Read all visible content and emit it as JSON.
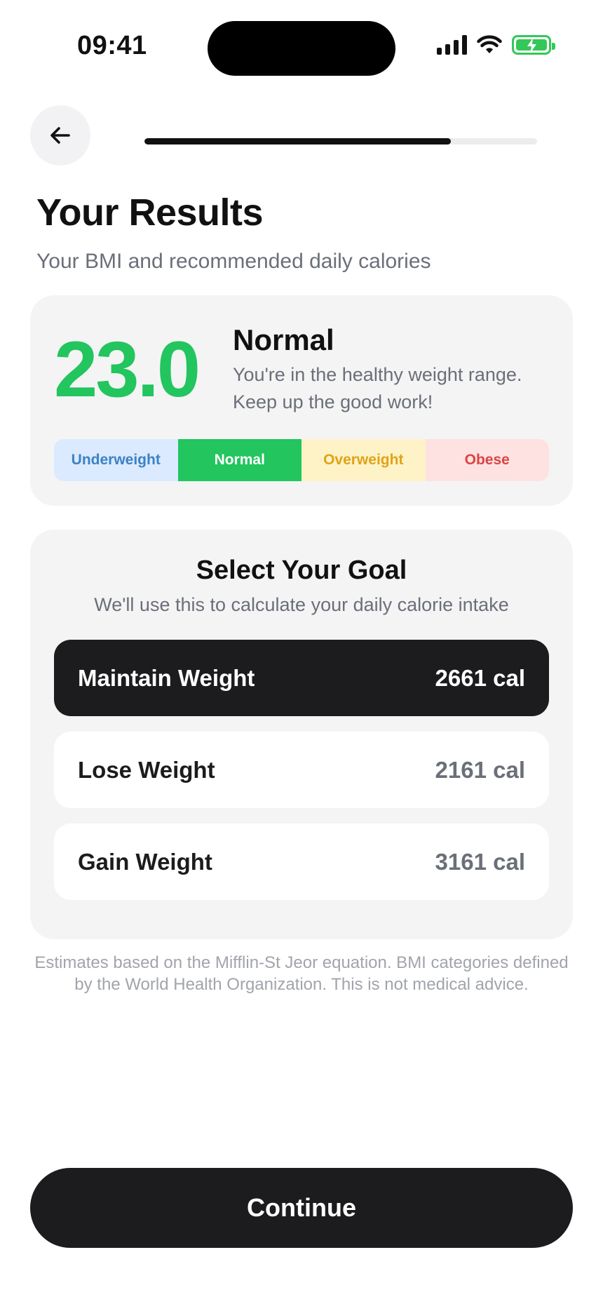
{
  "status_bar": {
    "time": "09:41",
    "icons": [
      "cellular-signal-icon",
      "wifi-icon",
      "battery-charging-icon"
    ],
    "battery_color": "#34c759"
  },
  "header": {
    "back_icon": "arrow-left-icon",
    "progress_fraction": 0.78
  },
  "page": {
    "title": "Your Results",
    "subtitle": "Your BMI and recommended daily calories"
  },
  "bmi": {
    "value": "23.0",
    "category": "Normal",
    "message": "You're in the healthy weight range. Keep up the good work!",
    "value_color": "#22c55e",
    "scale": [
      {
        "label": "Underweight",
        "active": false
      },
      {
        "label": "Normal",
        "active": true
      },
      {
        "label": "Overweight",
        "active": false
      },
      {
        "label": "Obese",
        "active": false
      }
    ]
  },
  "goal": {
    "title": "Select Your Goal",
    "subtitle": "We'll use this to calculate your daily calorie intake",
    "options": [
      {
        "label": "Maintain Weight",
        "calories": "2661 cal",
        "selected": true
      },
      {
        "label": "Lose Weight",
        "calories": "2161 cal",
        "selected": false
      },
      {
        "label": "Gain Weight",
        "calories": "3161 cal",
        "selected": false
      }
    ]
  },
  "disclaimer": "Estimates based on the Mifflin-St Jeor equation. BMI categories defined by the World Health Organization. This is not medical advice.",
  "continue_label": "Continue"
}
